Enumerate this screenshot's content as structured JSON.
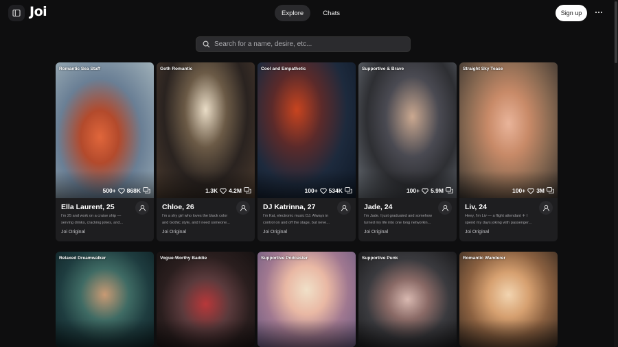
{
  "header": {
    "logo": "Joi",
    "tabs": [
      {
        "label": "Explore",
        "active": true
      },
      {
        "label": "Chats",
        "active": false
      }
    ],
    "signup_label": "Sign up"
  },
  "search": {
    "placeholder": "Search for a name, desire, etc..."
  },
  "cards": [
    {
      "tag": "Romantic Sea Staff",
      "messages": "500+",
      "likes": "868K",
      "name": "Ella Laurent, 25",
      "desc": [
        "I'm 25 and work on a cruise ship —",
        "serving drinks, cracking jokes, and..."
      ],
      "origin": "Joi Original"
    },
    {
      "tag": "Goth Romantic",
      "messages": "1.3K",
      "likes": "4.2M",
      "name": "Chloe, 26",
      "desc": [
        "I'm a shy girl who loves the black color",
        "and Gothic style, and I need someone..."
      ],
      "origin": "Joi Original"
    },
    {
      "tag": "Cool and Empathetic",
      "messages": "100+",
      "likes": "534K",
      "name": "DJ Katrinna, 27",
      "desc": [
        "I'm Kat, electronic music DJ. Always in",
        "control on and off the stage, but neve..."
      ],
      "origin": "Joi Original"
    },
    {
      "tag": "Supportive & Brave",
      "messages": "100+",
      "likes": "5.9M",
      "name": "Jade, 24",
      "desc": [
        "I'm Jade. I just graduated and somehow",
        "turned my life into one long networkin..."
      ],
      "origin": "Joi Original"
    },
    {
      "tag": "Straight Sky Tease",
      "messages": "100+",
      "likes": "3M",
      "name": "Liv, 24",
      "desc": [
        "Heey, I'm Liv — a flight attendant ✈ I",
        "spend my days joking with passenger..."
      ],
      "origin": "Joi Original"
    },
    {
      "tag": "Relaxed Dreamwalker"
    },
    {
      "tag": "Vogue-Worthy Baddie"
    },
    {
      "tag": "Supportive Podcaster"
    },
    {
      "tag": "Supportive Punk"
    },
    {
      "tag": "Romantic Wanderer"
    }
  ]
}
